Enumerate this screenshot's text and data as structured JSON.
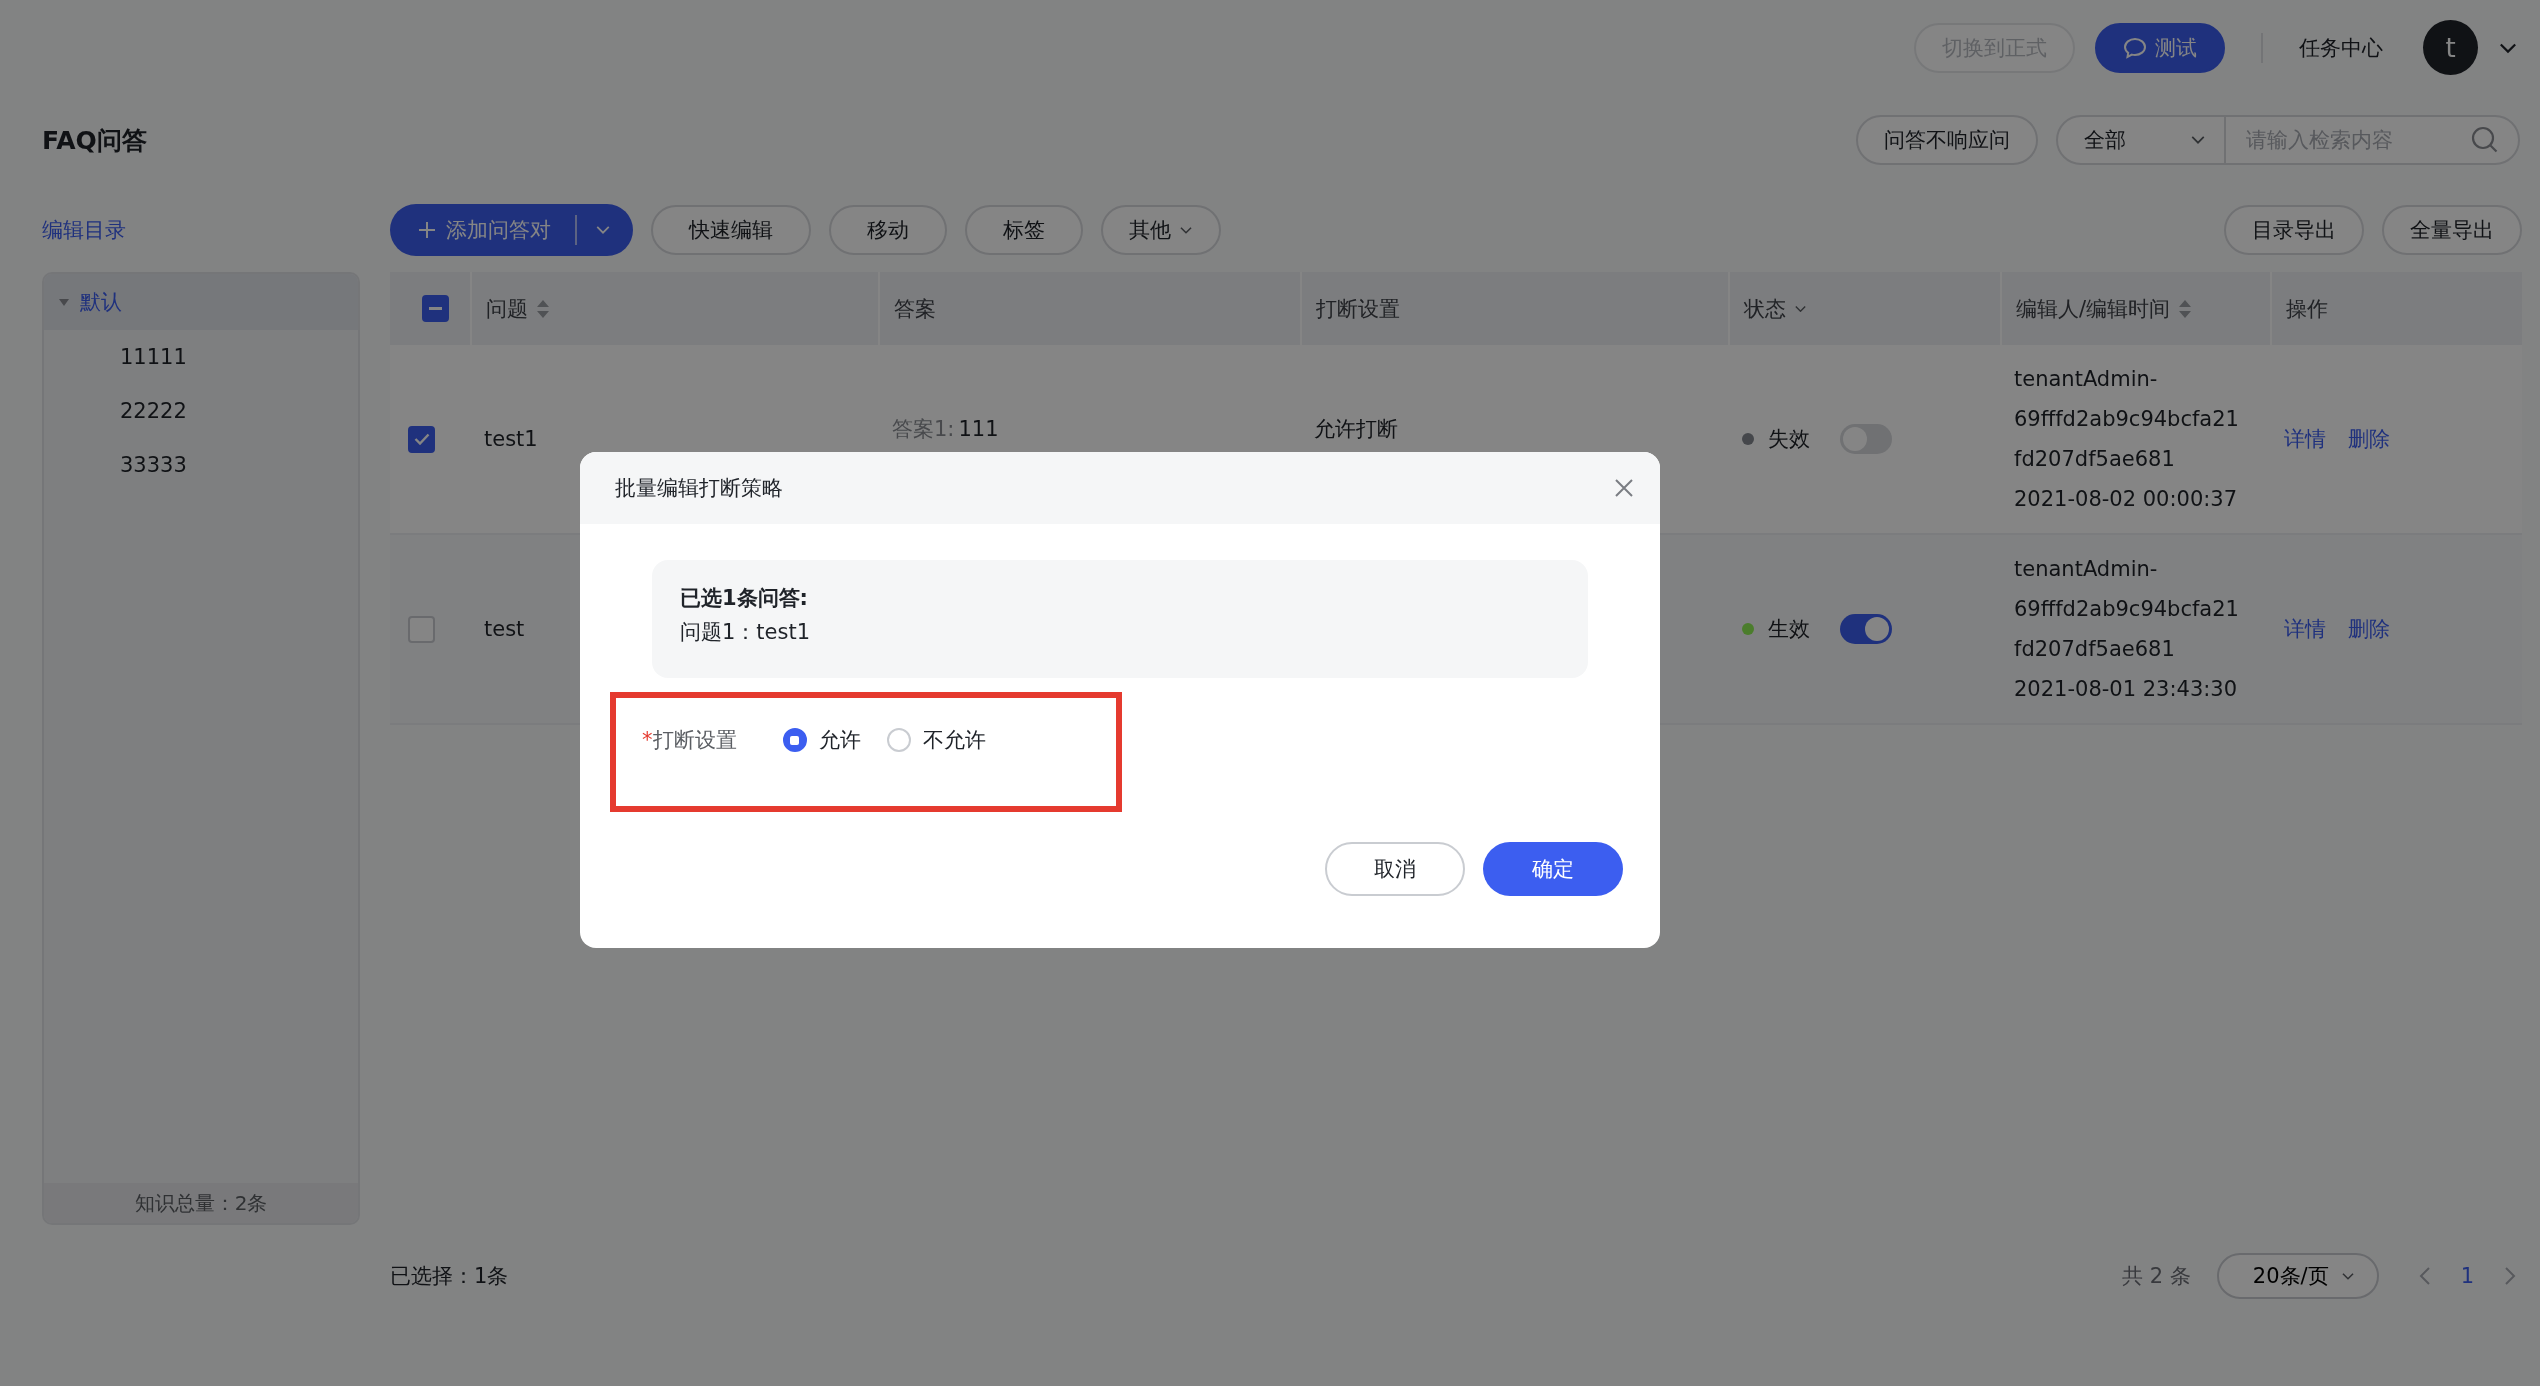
{
  "top_bar": {
    "switch_button": {
      "label": "切换到正式",
      "disabled": true
    },
    "test_button": {
      "label": "测试"
    },
    "task_center": "任务中心",
    "avatar": "t"
  },
  "page_title": "FAQ问答",
  "filters": {
    "unresponsive_button": "问答不响应问",
    "scope_select": "全部",
    "search": {
      "placeholder": "请输入检索内容"
    }
  },
  "toolbar": {
    "add_button": "添加问答对",
    "buttons": [
      {
        "label": "快速编辑",
        "kind": "plain"
      },
      {
        "label": "移动",
        "kind": "plain"
      },
      {
        "label": "标签",
        "kind": "plain"
      },
      {
        "label": "其他",
        "kind": "dropdown"
      }
    ],
    "export_buttons": [
      "目录导出",
      "全量导出"
    ]
  },
  "sidebar": {
    "edit_link": "编辑目录",
    "tree": [
      {
        "label": "默认",
        "expanded": true,
        "selected": true,
        "children": [
          {
            "label": "11111",
            "selected": false
          },
          {
            "label": "22222",
            "selected": false
          },
          {
            "label": "33333",
            "selected": false
          }
        ]
      }
    ],
    "total": "知识总量：2条"
  },
  "table": {
    "select_all": {
      "indeterminate": true
    },
    "columns": [
      {
        "label": "问题",
        "kind": "sort"
      },
      {
        "label": "答案",
        "kind": "plain"
      },
      {
        "label": "打断设置",
        "kind": "plain"
      },
      {
        "label": "状态",
        "kind": "filter"
      },
      {
        "label": "编辑人/编辑时间",
        "kind": "sort"
      },
      {
        "label": "操作",
        "kind": "plain"
      }
    ],
    "rows": [
      {
        "checked": true,
        "question": "test1",
        "answer_label": "答案1:",
        "answer": "111",
        "interrupt": "允许打断",
        "status": "失效",
        "color": "#45474b",
        "enabled": false,
        "editor_lines": [
          "tenantAdmin-",
          "69fffd2ab9c94bcfa21",
          "fd207df5ae681"
        ],
        "time": "2021-08-02 00:00:37",
        "actions": [
          "详情",
          "删除"
        ]
      },
      {
        "checked": false,
        "question": "test",
        "status": "生效",
        "color": "#4b7d2c",
        "enabled": true,
        "editor_lines": [
          "tenantAdmin-",
          "69fffd2ab9c94bcfa21",
          "fd207df5ae681"
        ],
        "time": "2021-08-01 23:43:30",
        "actions": [
          "详情",
          "删除"
        ]
      }
    ]
  },
  "footer": {
    "selected_count": "已选择：1条",
    "total": "共 2 条",
    "page_size": "20条/页",
    "pages": [
      {
        "label": "1",
        "selected": true
      }
    ]
  },
  "modal": {
    "title": "批量编辑打断策略",
    "summary_title": "已选1条问答:",
    "summary_items": [
      "问题1：test1"
    ],
    "field": {
      "label": "打断设置",
      "required_mark": "*",
      "highlighted": true,
      "options": [
        {
          "label": "允许",
          "selected": true
        },
        {
          "label": "不允许",
          "selected": false
        }
      ]
    },
    "cancel_button": "取消",
    "confirm_button": "确定"
  }
}
